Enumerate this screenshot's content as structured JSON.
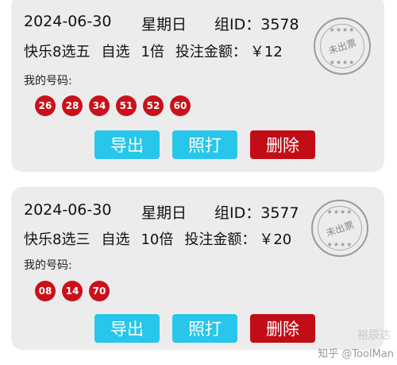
{
  "tickets": [
    {
      "date": "2024-06-30",
      "weekday": "星期日",
      "group_id": "组ID：3578",
      "game": "快乐8选五",
      "pick_type": "自选",
      "multiplier": "1倍",
      "amount_label": "投注金额：",
      "amount": "￥12",
      "my_numbers_label": "我的号码:",
      "numbers": [
        "26",
        "28",
        "34",
        "51",
        "52",
        "60"
      ],
      "stamp_text": "未出票",
      "buttons": {
        "export": "导出",
        "photo": "照打",
        "delete": "删除"
      }
    },
    {
      "date": "2024-06-30",
      "weekday": "星期日",
      "group_id": "组ID：3577",
      "game": "快乐8选三",
      "pick_type": "自选",
      "multiplier": "10倍",
      "amount_label": "投注金额：",
      "amount": "￥20",
      "my_numbers_label": "我的号码:",
      "numbers": [
        "08",
        "14",
        "70"
      ],
      "stamp_text": "未出票",
      "buttons": {
        "export": "导出",
        "photo": "照打",
        "delete": "删除"
      }
    }
  ],
  "watermark": "知乎 @ToolMan",
  "watermark2": "裕辰达",
  "colors": {
    "ball": "#c9111b",
    "button_blue": "#27c6ea",
    "button_red": "#c30d16",
    "card_bg": "#ececec"
  }
}
